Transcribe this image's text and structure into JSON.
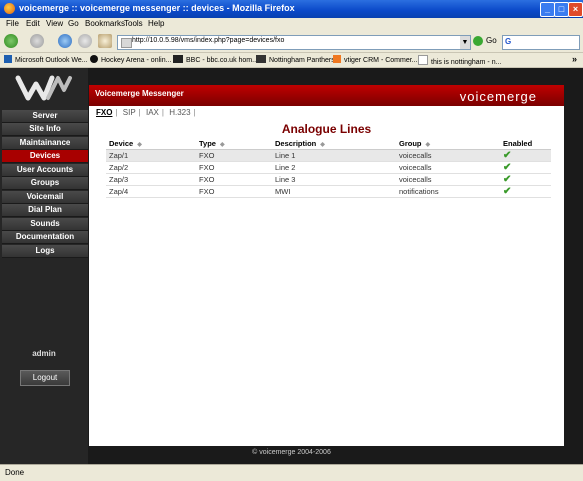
{
  "window": {
    "title": "voicemerge :: voicemerge messenger :: devices - Mozilla Firefox",
    "min": "_",
    "max": "□",
    "close": "×"
  },
  "menu": [
    "File",
    "Edit",
    "View",
    "Go",
    "Bookmarks",
    "Tools",
    "Help"
  ],
  "address": {
    "url": "http://10.0.5.98/vms/index.php?page=devices/fxo",
    "go": "Go",
    "search_icon": "G"
  },
  "bookmarks": [
    {
      "label": "Microsoft Outlook We...",
      "icon": "outlook-icon",
      "color": "#1e5fb0"
    },
    {
      "label": "Hockey Arena - onlin...",
      "icon": "hockey-icon",
      "color": "#111111"
    },
    {
      "label": "BBC - bbc.co.uk hom...",
      "icon": "bbc-icon",
      "color": "#222222"
    },
    {
      "label": "Nottingham Panthers",
      "icon": "panthers-icon",
      "color": "#333333"
    },
    {
      "label": "vtiger CRM - Commer...",
      "icon": "vtiger-icon",
      "color": "#f07820"
    },
    {
      "label": "this is nottingham - n...",
      "icon": "page-icon",
      "color": "#dddddd"
    }
  ],
  "sidebar": {
    "items": [
      {
        "label": "Server",
        "active": false
      },
      {
        "label": "Site Info",
        "active": false
      },
      {
        "label": "Maintainance",
        "active": false
      },
      {
        "label": "Devices",
        "active": true
      },
      {
        "label": "User Accounts",
        "active": false
      },
      {
        "label": "Groups",
        "active": false
      },
      {
        "label": "Voicemail",
        "active": false
      },
      {
        "label": "Dial Plan",
        "active": false
      },
      {
        "label": "Sounds",
        "active": false
      },
      {
        "label": "Documentation",
        "active": false
      },
      {
        "label": "Logs",
        "active": false
      }
    ],
    "user": "admin",
    "logout": "Logout"
  },
  "header": {
    "app": "Voicemerge Messenger",
    "brand": "voicemerge"
  },
  "subtabs": [
    {
      "label": "FXO",
      "selected": true
    },
    {
      "label": "SIP",
      "selected": false
    },
    {
      "label": "IAX",
      "selected": false
    },
    {
      "label": "H.323",
      "selected": false
    }
  ],
  "page_title": "Analogue Lines",
  "table": {
    "columns": [
      "Device",
      "Type",
      "Description",
      "Group",
      "Enabled"
    ],
    "sortable": [
      true,
      true,
      true,
      true,
      false
    ],
    "rows": [
      [
        "Zap/1",
        "FXO",
        "Line 1",
        "voicecalls",
        true
      ],
      [
        "Zap/2",
        "FXO",
        "Line 2",
        "voicecalls",
        true
      ],
      [
        "Zap/3",
        "FXO",
        "Line 3",
        "voicecalls",
        true
      ],
      [
        "Zap/4",
        "FXO",
        "MWI",
        "notifications",
        true
      ]
    ]
  },
  "footer": "© voicemerge 2004-2006",
  "status": "Done",
  "colors": {
    "accent": "#a80000",
    "header_dark": "#7a0000",
    "sidebar": "#262626"
  }
}
